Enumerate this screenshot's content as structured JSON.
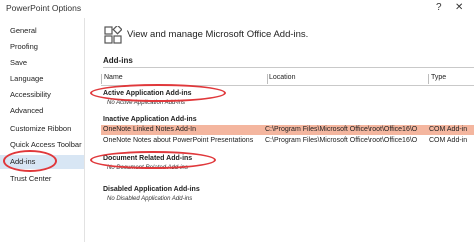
{
  "window": {
    "title": "PowerPoint Options",
    "help": "?",
    "close": "✕"
  },
  "sidebar": {
    "items": [
      {
        "label": "General"
      },
      {
        "label": "Proofing"
      },
      {
        "label": "Save"
      },
      {
        "label": "Language"
      },
      {
        "label": "Accessibility"
      },
      {
        "label": "Advanced"
      },
      {
        "label": "Customize Ribbon"
      },
      {
        "label": "Quick Access Toolbar"
      },
      {
        "label": "Add-ins",
        "selected": true
      },
      {
        "label": "Trust Center"
      }
    ]
  },
  "main": {
    "header": {
      "icon": "add-ins-icon",
      "text": "View and manage Microsoft Office Add-ins."
    },
    "section_title": "Add-ins",
    "columns": {
      "name": "Name",
      "location": "Location",
      "type": "Type"
    },
    "groups": {
      "active": {
        "title": "Active Application Add-ins",
        "empty": "No Active Application Add-ins"
      },
      "inactive": {
        "title": "Inactive Application Add-ins",
        "rows": [
          {
            "name": "OneNote Linked Notes Add-In",
            "location": "C:\\Program Files\\Microsoft Office\\root\\Office16\\O",
            "type": "COM Add-in",
            "highlighted": true
          },
          {
            "name": "OneNote Notes about PowerPoint Presentations",
            "location": "C:\\Program Files\\Microsoft Office\\root\\Office16\\O",
            "type": "COM Add-in"
          }
        ]
      },
      "document": {
        "title": "Document Related Add-ins",
        "empty": "No Document Related Add-ins"
      },
      "disabled": {
        "title": "Disabled Application Add-ins",
        "empty": "No Disabled Application Add-ins"
      }
    }
  },
  "colors": {
    "highlight_row": "#f4b69f",
    "selected_nav": "#d8e6f4",
    "annotation_ring": "#e0383b"
  }
}
